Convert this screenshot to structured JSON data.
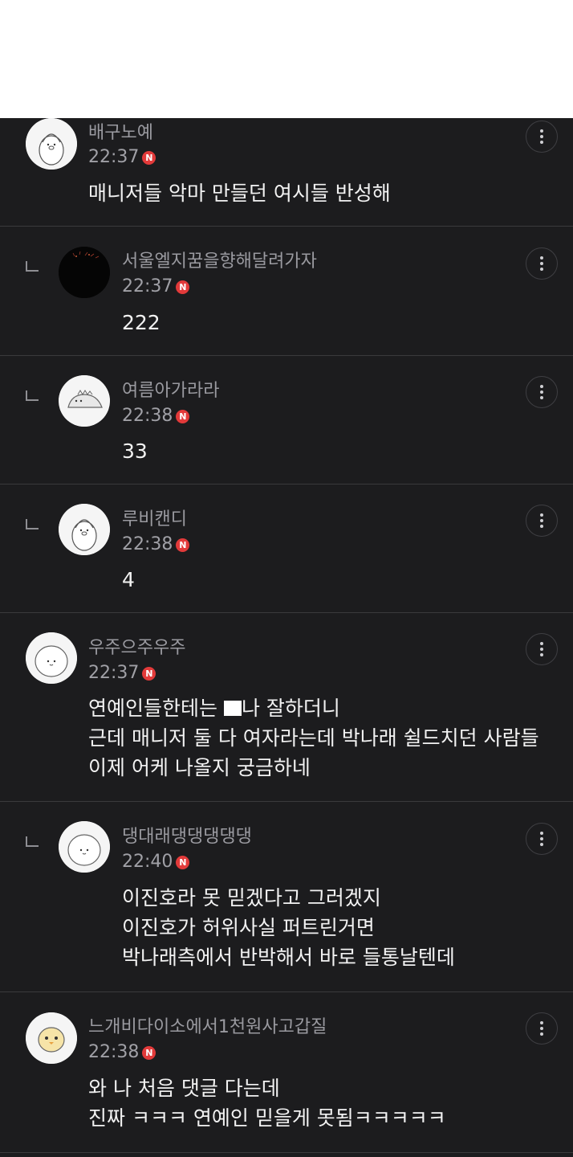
{
  "badge_label": "N",
  "comments": [
    {
      "nick": "배구노예",
      "time": "22:37",
      "lines": [
        "매니저들 악마 만들던 여시들 반성해"
      ],
      "reply": false,
      "avatar_icon": "penguin-character-icon"
    },
    {
      "nick": "서울엘지꿈을향해달려가자",
      "time": "22:37",
      "lines": [
        "222"
      ],
      "reply": true,
      "avatar_icon": "fireworks-photo-icon"
    },
    {
      "nick": "여름아가라라",
      "time": "22:38",
      "lines": [
        "33"
      ],
      "reply": true,
      "avatar_icon": "dinosaur-character-icon"
    },
    {
      "nick": "루비캔디",
      "time": "22:38",
      "lines": [
        "4"
      ],
      "reply": true,
      "avatar_icon": "penguin-character-icon"
    },
    {
      "nick": "우주으주우주",
      "time": "22:37",
      "lines": [
        "연예인들한테는 ",
        "나 잘하더니",
        "근데 매니저 둘 다 여자라는데 박나래 쉴드치던 사람들",
        "이제 어케 나올지 궁금하네"
      ],
      "reply": false,
      "avatar_icon": "round-character-icon"
    },
    {
      "nick": "댕대래댕댕댕댕댕",
      "time": "22:40",
      "lines": [
        "이진호라 못 믿겠다고 그러겠지",
        "이진호가 허위사실 퍼트린거면",
        "박나래측에서 반박해서 바로 들통날텐데"
      ],
      "reply": true,
      "avatar_icon": "round-character-icon"
    },
    {
      "nick": "느개비다이소에서1천원사고갑질",
      "time": "22:38",
      "lines": [
        "와 나 처음 댓글 다는데",
        "진짜 ㅋㅋㅋ 연예인 믿을게 못됨ㅋㅋㅋㅋㅋ"
      ],
      "reply": false,
      "avatar_icon": "chick-character-icon"
    }
  ],
  "colors": {
    "background": "#1c1c1e",
    "divider": "#3a3a3c",
    "badge": "#e23a3a"
  }
}
